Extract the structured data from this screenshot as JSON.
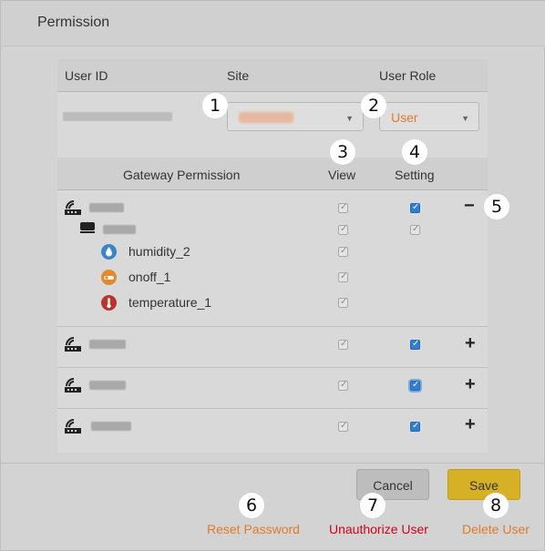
{
  "dialog": {
    "title": "Permission"
  },
  "user_table": {
    "headers": {
      "user_id": "User ID",
      "site": "Site",
      "user_role": "User Role"
    },
    "user_role_value": "User"
  },
  "gateway_table": {
    "headers": {
      "gateway_permission": "Gateway Permission",
      "view": "View",
      "setting": "Setting"
    },
    "sensors": [
      {
        "label": "humidity_2",
        "icon": "droplet-icon",
        "color": "#3a86c8"
      },
      {
        "label": "onoff_1",
        "icon": "switch-icon",
        "color": "#e38a2d"
      },
      {
        "label": "temperature_1",
        "icon": "thermometer-icon",
        "color": "#b7352c"
      }
    ],
    "collapse_symbol": "−",
    "expand_symbol": "+"
  },
  "buttons": {
    "cancel": "Cancel",
    "save": "Save"
  },
  "links": {
    "reset_password": "Reset Password",
    "unauthorize_user": "Unauthorize User",
    "delete_user": "Delete User"
  },
  "callouts": [
    "1",
    "2",
    "3",
    "4",
    "5",
    "6",
    "7",
    "8"
  ],
  "colors": {
    "accent_orange": "#e07b2e",
    "danger_red": "#d0021b",
    "save_yellow": "#d6b125",
    "checkbox_blue": "#2f7fd2"
  }
}
